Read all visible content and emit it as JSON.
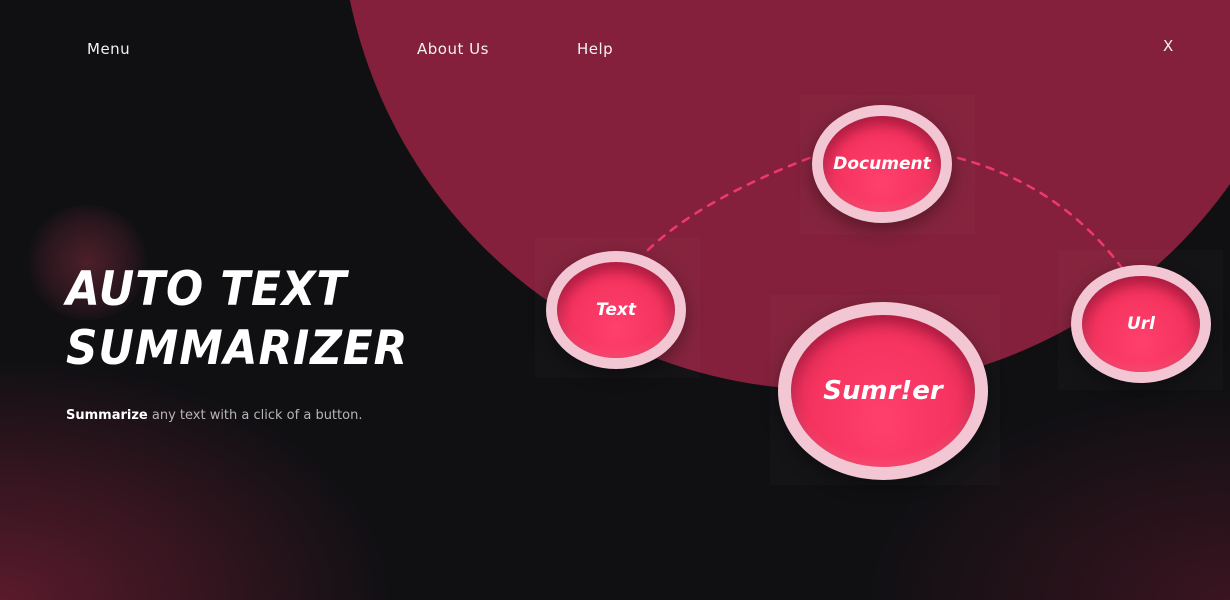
{
  "nav": {
    "menu_label": "Menu",
    "about_label": "About Us",
    "help_label": "Help",
    "close_label": "X"
  },
  "hero": {
    "title_line1": "AUTO TEXT",
    "title_line2": "SUMMARIZER",
    "tagline_bold": "Summarize",
    "tagline_rest": " any text with a click of a button."
  },
  "options": {
    "document_label": "Document",
    "text_label": "Text",
    "url_label": "Url",
    "main_label": "Sumr!er"
  },
  "colors": {
    "background": "#101013",
    "accent_circle": "#84203b",
    "bubble_fill": "#f5345f",
    "bubble_ring": "#f3c6d3",
    "dash_line": "#f0396a"
  }
}
